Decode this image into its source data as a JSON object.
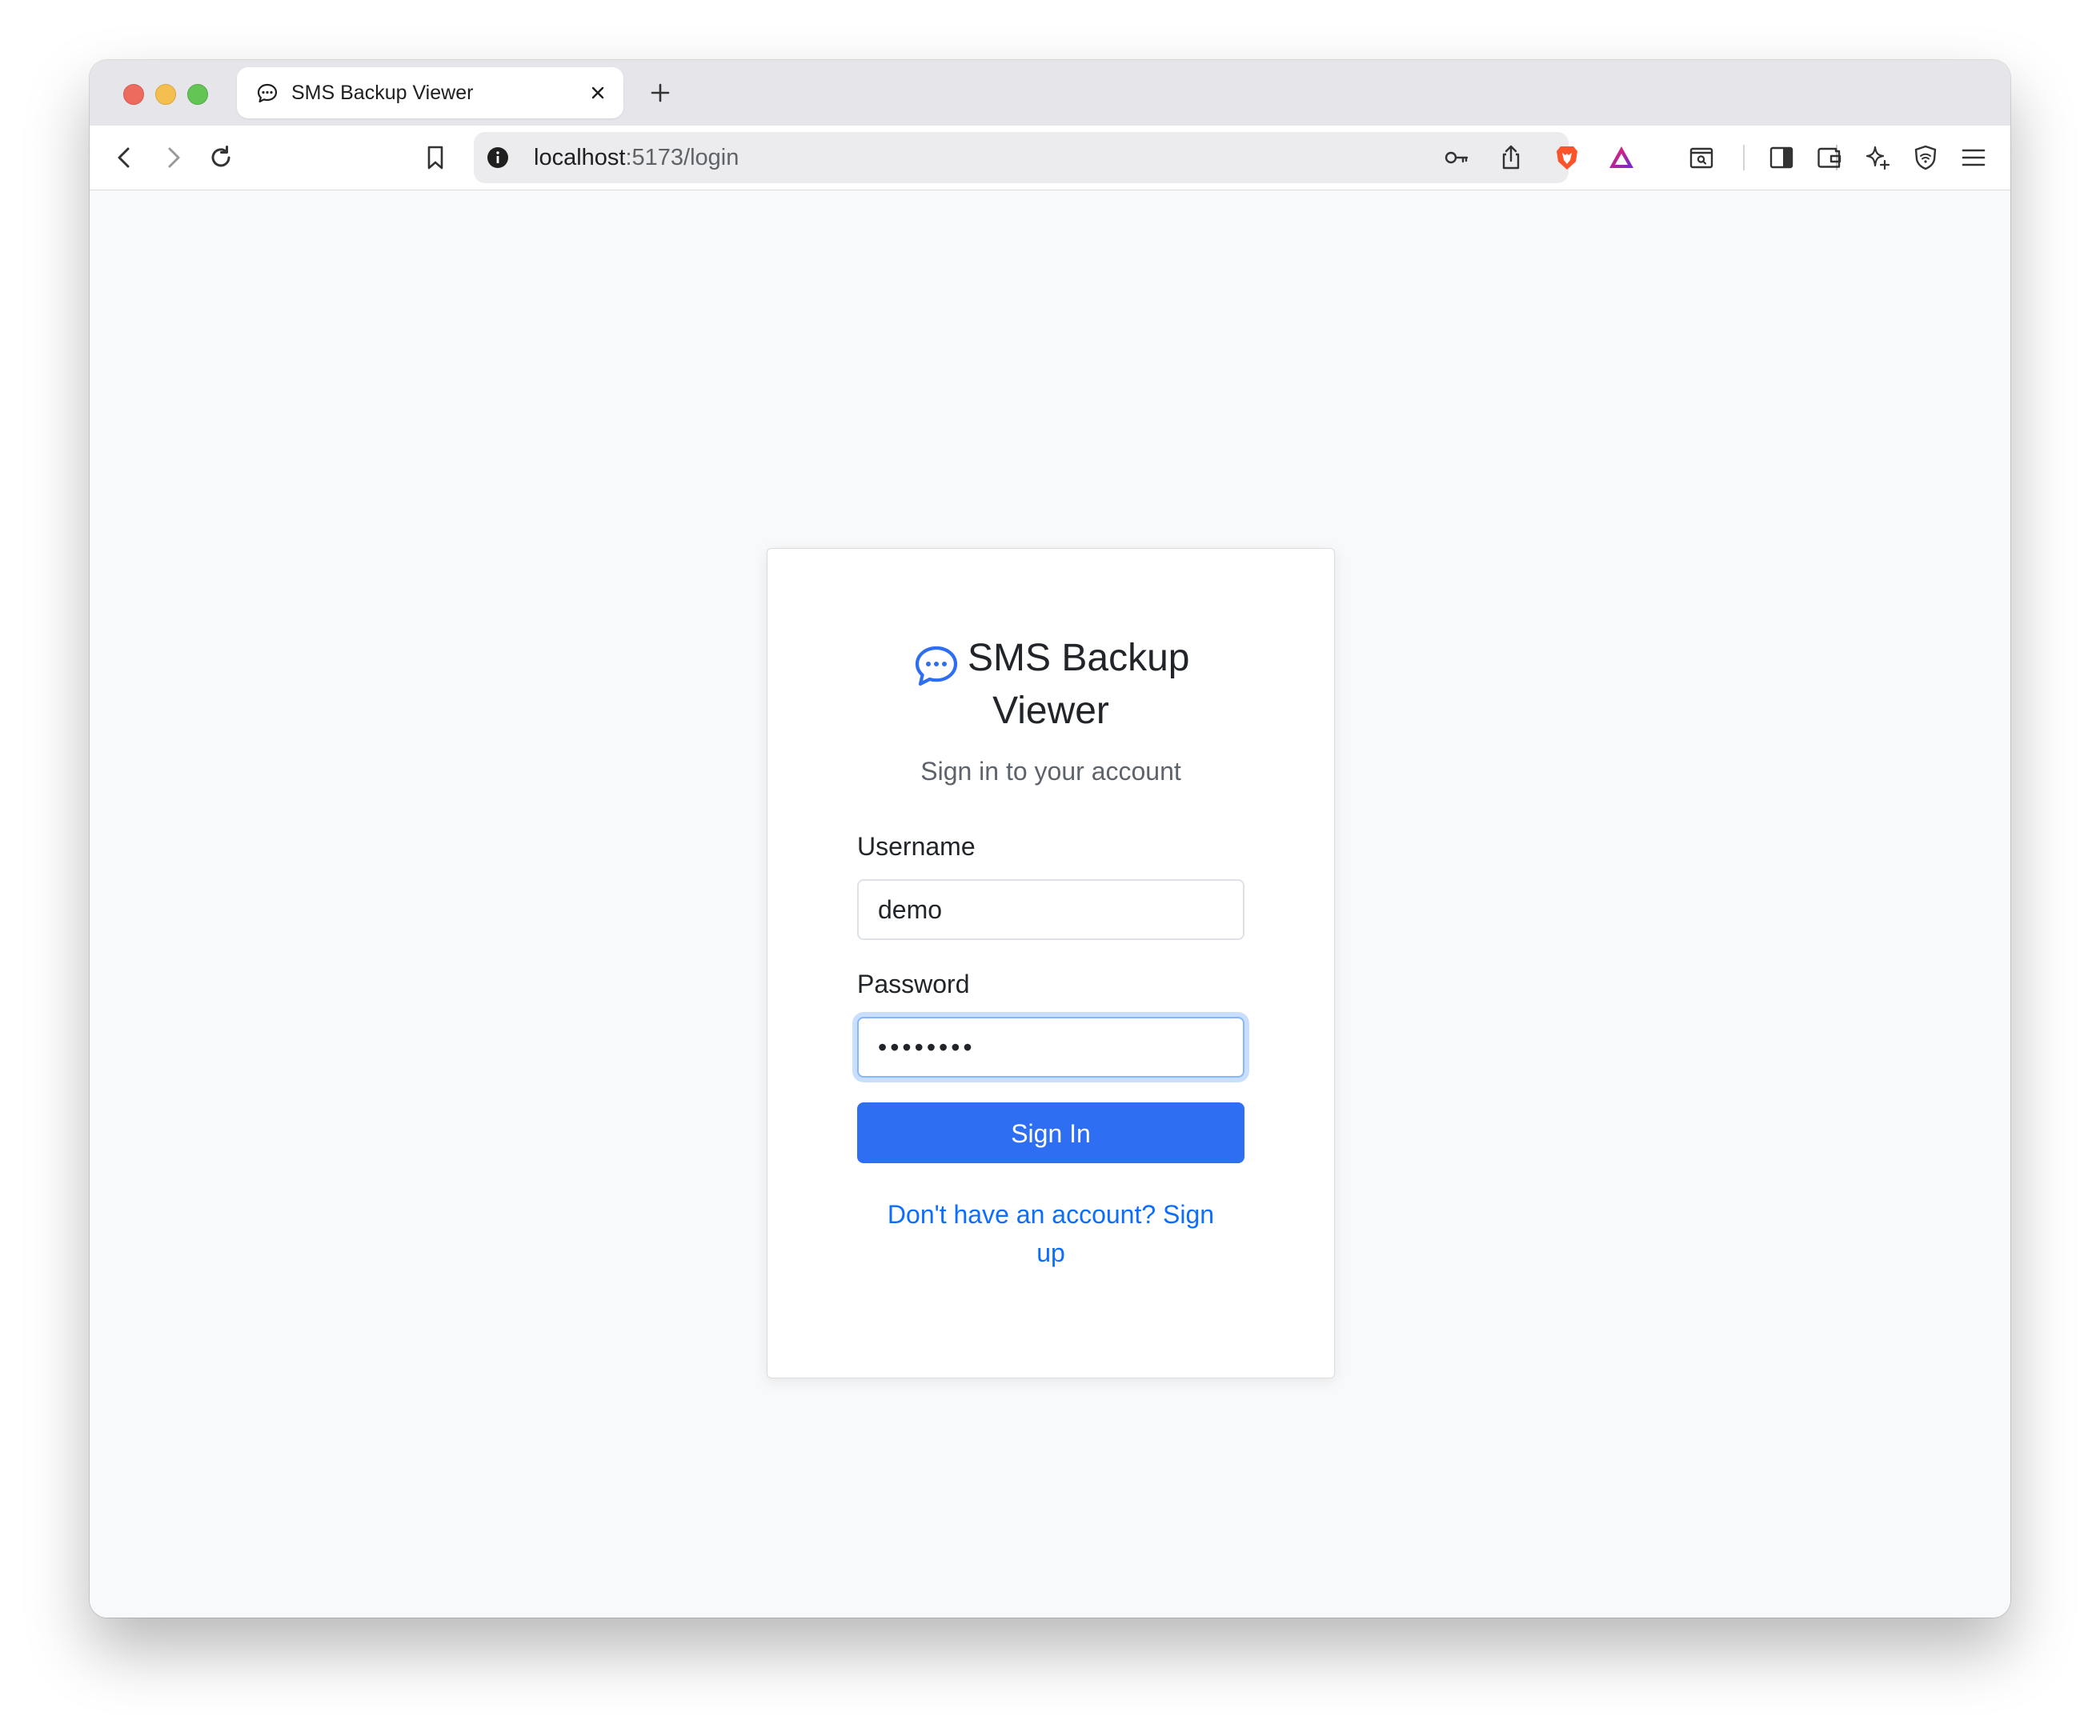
{
  "browser": {
    "tab": {
      "title": "SMS Backup Viewer",
      "icon": "chat-dots-icon"
    },
    "url": {
      "host": "localhost",
      "path": ":5173/login"
    }
  },
  "login": {
    "brand_title_line1": "SMS Backup",
    "brand_title_line2": "Viewer",
    "subtitle": "Sign in to your account",
    "username_label": "Username",
    "username_value": "demo",
    "password_label": "Password",
    "password_value": "password",
    "signin_label": "Sign In",
    "signup_link": "Don't have an account? Sign up"
  },
  "colors": {
    "primary": "#2e6ef3",
    "link": "#0d6efd",
    "background": "#f8f9fa"
  }
}
